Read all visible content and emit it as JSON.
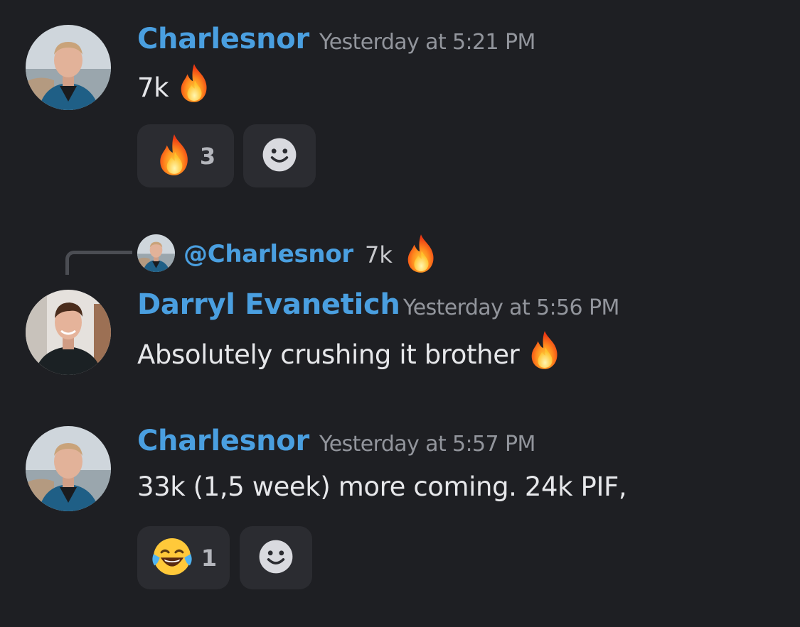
{
  "messages": [
    {
      "author": "Charlesnor",
      "timestamp": "Yesterday at 5:21 PM",
      "text": "7k",
      "emoji": "fire-emoji",
      "reactions": [
        {
          "emoji": "fire-emoji",
          "count": "3"
        }
      ]
    },
    {
      "reply_to": {
        "mention": "@Charlesnor",
        "text": "7k",
        "emoji": "fire-emoji"
      },
      "author": "Darryl Evanetich",
      "timestamp": "Yesterday at 5:56 PM",
      "text": "Absolutely crushing it brother",
      "emoji": "fire-emoji"
    },
    {
      "author": "Charlesnor",
      "timestamp": "Yesterday at 5:57 PM",
      "text": "33k (1,5 week) more coming. 24k PIF,",
      "reactions": [
        {
          "emoji": "tears-of-joy-emoji",
          "count": "1"
        }
      ]
    }
  ],
  "colors": {
    "background": "#1e1f23",
    "author_name": "#4a9fe0",
    "timestamp": "#92959c",
    "message_text": "#e6e7ea",
    "reaction_bg": "#2b2c31"
  },
  "icons": {
    "add_reaction": "smiley-add-reaction-icon"
  }
}
